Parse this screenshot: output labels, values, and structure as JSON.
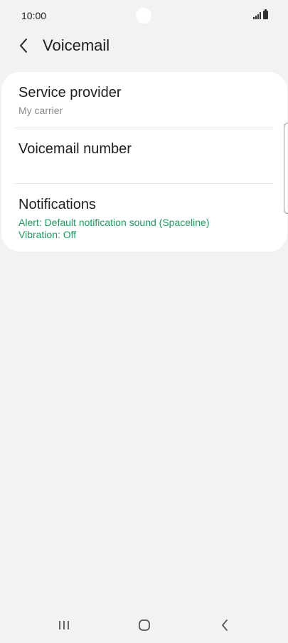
{
  "status_bar": {
    "time": "10:00"
  },
  "header": {
    "title": "Voicemail",
    "back_icon": "chevron-left-icon"
  },
  "settings": {
    "items": [
      {
        "title": "Service provider",
        "subtitle": "My carrier"
      },
      {
        "title": "Voicemail number",
        "subtitle": ""
      },
      {
        "title": "Notifications",
        "alert": "Alert: Default notification sound (Spaceline)",
        "vibration": "Vibration: Off"
      }
    ]
  },
  "colors": {
    "background": "#f2f2f2",
    "card": "#ffffff",
    "accent_green": "#1a9e5f",
    "subtitle_gray": "#8a8a8a"
  },
  "nav_bar": {
    "icons": [
      "recent-apps-icon",
      "home-icon",
      "back-icon"
    ]
  }
}
